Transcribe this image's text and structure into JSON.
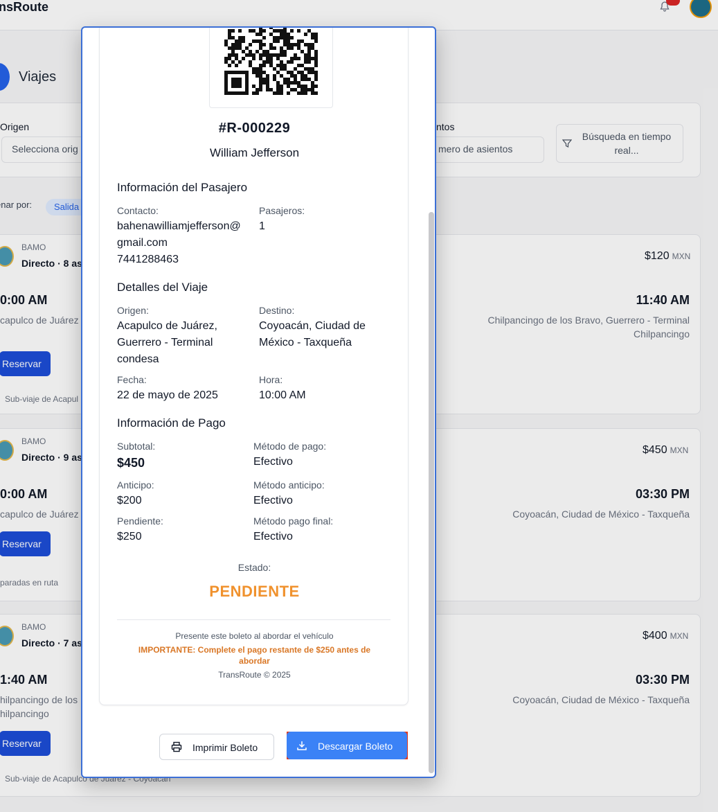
{
  "app": {
    "brand": "nsRoute"
  },
  "page": {
    "title": "Viajes"
  },
  "filters": {
    "origin_label": "Origen",
    "origin_placeholder": "Selecciona orig",
    "seats_label": "ntos",
    "seats_placeholder": "mero de asientos",
    "search_label": "Búsqueda en tiempo real..."
  },
  "sort": {
    "label": "enar por:",
    "chip": "Salida"
  },
  "trips": [
    {
      "company": "BAMO",
      "type": "Directo · 8 as",
      "dep_time": "0:00 AM",
      "dep_place": "capulco de Juárez",
      "btn": "Reservar",
      "note": "Sub-viaje de Acapul",
      "price": "$120",
      "currency": "MXN",
      "arr_time": "11:40 AM",
      "arr_place": "Chilpancingo de los Bravo, Guerrero - Terminal Chilpancingo"
    },
    {
      "company": "BAMO",
      "type": "Directo · 9 as",
      "dep_time": "0:00 AM",
      "dep_place": "capulco de Juárez",
      "btn": "Reservar",
      "note": "paradas en ruta",
      "price": "$450",
      "currency": "MXN",
      "arr_time": "03:30 PM",
      "arr_place": "Coyoacán, Ciudad de México - Taxqueña"
    },
    {
      "company": "BAMO",
      "type": "Directo · 7 as",
      "dep_time": "1:40 AM",
      "dep_place": "hilpancingo de los",
      "dep_place2": "hilpancingo",
      "btn": "Reservar",
      "note": "Sub-viaje de Acapulco de Juárez - Coyoacán",
      "price": "$400",
      "currency": "MXN",
      "arr_time": "03:30 PM",
      "arr_place": "Coyoacán, Ciudad de México - Taxqueña"
    }
  ],
  "ticket": {
    "reservation_id": "#R-000229",
    "passenger_name": "William Jefferson",
    "passenger_section": "Información del Pasajero",
    "contact_label": "Contacto:",
    "email_line1": "bahenawilliamjefferson@",
    "email_line2": "gmail.com",
    "phone": "7441288463",
    "passengers_label": "Pasajeros:",
    "passengers": "1",
    "trip_section": "Detalles del Viaje",
    "origin_label": "Origen:",
    "origin_line1": "Acapulco de Juárez,",
    "origin_line2": "Guerrero - Terminal",
    "origin_line3": "condesa",
    "destination_label": "Destino:",
    "destination_line1": "Coyoacán, Ciudad de",
    "destination_line2": "México - Taxqueña",
    "date_label": "Fecha:",
    "date": "22 de mayo de 2025",
    "time_label": "Hora:",
    "time": "10:00 AM",
    "payment_section": "Información de Pago",
    "subtotal_label": "Subtotal:",
    "subtotal": "$450",
    "pay_method_label": "Método de pago:",
    "pay_method": "Efectivo",
    "advance_label": "Anticipo:",
    "advance": "$200",
    "advance_method_label": "Método anticipo:",
    "advance_method": "Efectivo",
    "pending_label": "Pendiente:",
    "pending": "$250",
    "final_method_label": "Método pago final:",
    "final_method": "Efectivo",
    "status_label": "Estado:",
    "status": "PENDIENTE",
    "footer_present": "Presente este boleto al abordar el vehículo",
    "footer_important": "IMPORTANTE: Complete el pago restante de $250 antes de abordar",
    "footer_copyright": "TransRoute © 2025"
  },
  "actions": {
    "print": "Imprimir Boleto",
    "download": "Descargar Boleto"
  },
  "colors": {
    "status_pending": "#f0922e",
    "primary": "#3b82f6",
    "highlight": "#e03a1e"
  }
}
